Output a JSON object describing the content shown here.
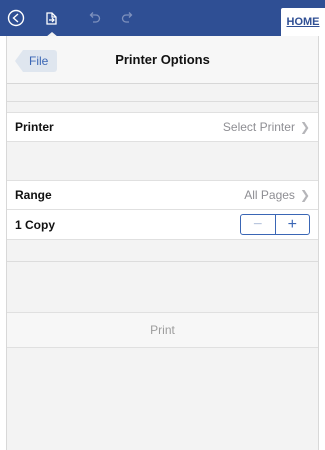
{
  "header": {
    "home_tab_label": "HOME",
    "icons": [
      "back-circle-icon",
      "save-document-icon",
      "undo-icon",
      "redo-icon"
    ],
    "bar_color": "#2f4f94"
  },
  "navbar": {
    "back_label": "File",
    "title": "Printer Options"
  },
  "printer_row": {
    "label": "Printer",
    "value": "Select Printer"
  },
  "range_row": {
    "label": "Range",
    "value": "All Pages"
  },
  "copies_row": {
    "label": "1 Copy",
    "minus_symbol": "−",
    "plus_symbol": "+"
  },
  "print_button": {
    "label": "Print"
  },
  "colors": {
    "accent": "#3a66b5",
    "secondary_text": "#8e8e93"
  }
}
